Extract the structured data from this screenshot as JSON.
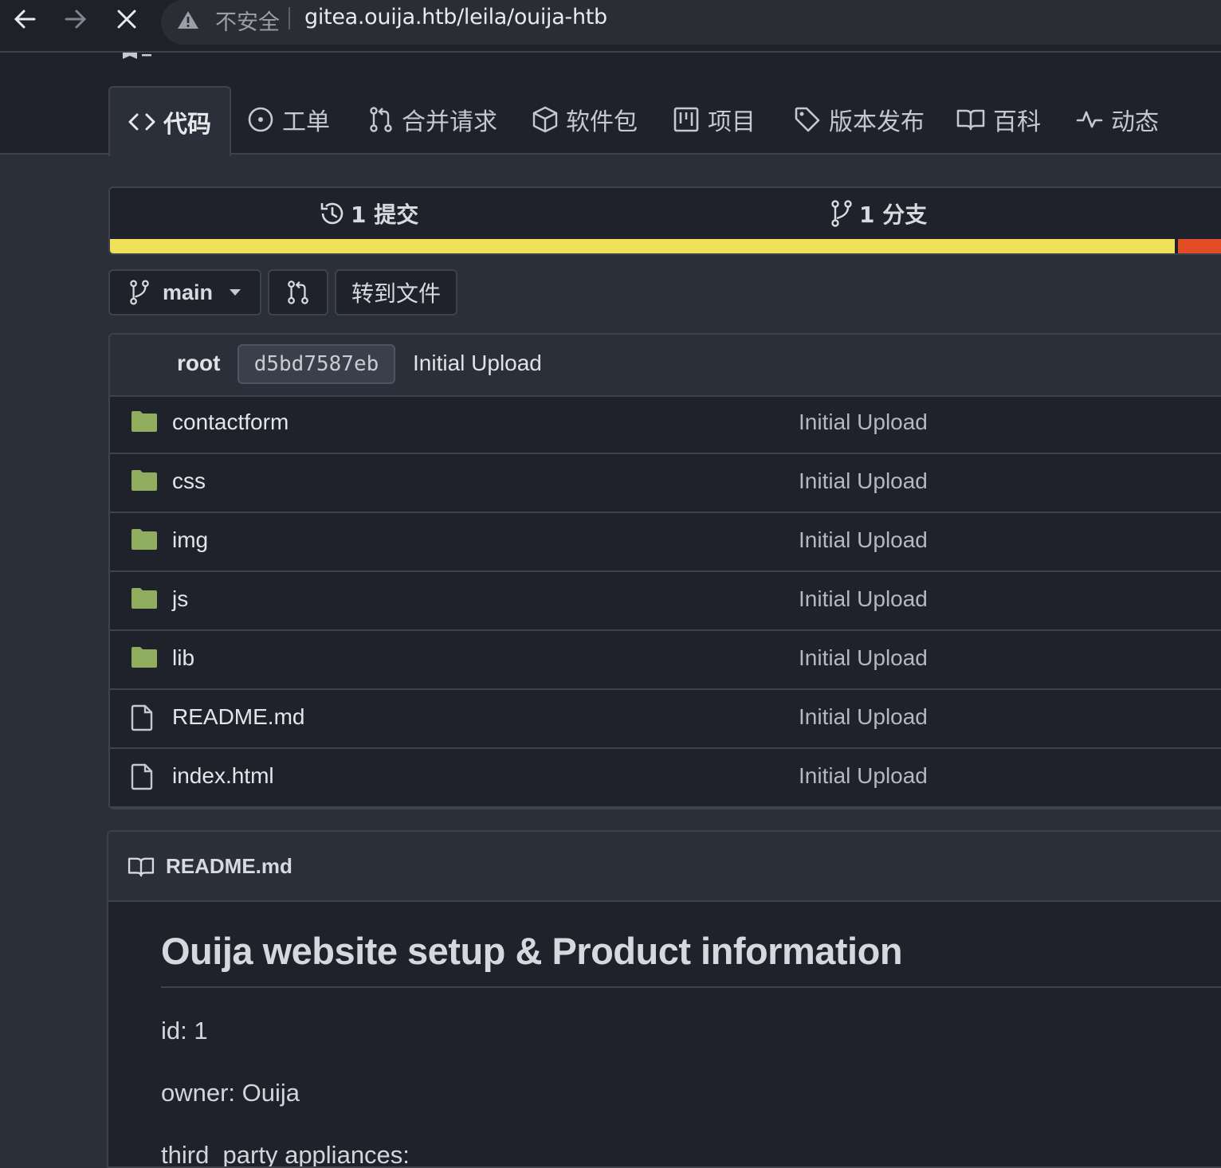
{
  "browser": {
    "insecure_label": "不安全",
    "url": "gitea.ouija.htb/leila/ouija-htb"
  },
  "tabs": [
    {
      "label": "代码",
      "icon": "code-icon"
    },
    {
      "label": "工单",
      "icon": "issue-icon"
    },
    {
      "label": "合并请求",
      "icon": "pull-request-icon"
    },
    {
      "label": "软件包",
      "icon": "package-icon"
    },
    {
      "label": "项目",
      "icon": "project-icon"
    },
    {
      "label": "版本发布",
      "icon": "tag-icon"
    },
    {
      "label": "百科",
      "icon": "book-icon"
    },
    {
      "label": "动态",
      "icon": "pulse-icon"
    }
  ],
  "stats": {
    "commits": "1 提交",
    "branches": "1 分支"
  },
  "language_colors": [
    "#f1e05a",
    "#e34c26"
  ],
  "branch_bar": {
    "branch": "main",
    "goto_file": "转到文件"
  },
  "latest_commit": {
    "author": "root",
    "sha": "d5bd7587eb",
    "message": "Initial Upload"
  },
  "files": [
    {
      "name": "contactform",
      "type": "folder",
      "message": "Initial Upload"
    },
    {
      "name": "css",
      "type": "folder",
      "message": "Initial Upload"
    },
    {
      "name": "img",
      "type": "folder",
      "message": "Initial Upload"
    },
    {
      "name": "js",
      "type": "folder",
      "message": "Initial Upload"
    },
    {
      "name": "lib",
      "type": "folder",
      "message": "Initial Upload"
    },
    {
      "name": "README.md",
      "type": "file",
      "message": "Initial Upload"
    },
    {
      "name": "index.html",
      "type": "file",
      "message": "Initial Upload"
    }
  ],
  "readme": {
    "filename": "README.md",
    "title": "Ouija website setup & Product information",
    "lines": [
      "id: 1",
      "owner: Ouija",
      "third_party appliances:"
    ]
  }
}
